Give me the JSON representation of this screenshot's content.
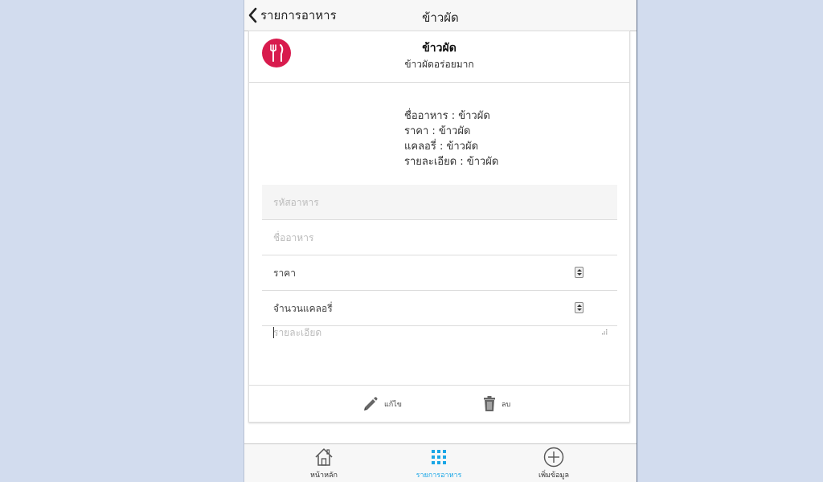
{
  "navbar": {
    "back_label": "รายการอาหาร",
    "title": "ข้าวผัด"
  },
  "card": {
    "title": "ข้าวผัด",
    "subtitle": "ข้าวผัดอร่อยมาก",
    "avatar_color": "#d81b4d",
    "avatar_icon": "fork-knife-icon",
    "info": [
      "ชื่ออาหาร : ข้าวผัด",
      "ราคา : ข้าวผัด",
      "แคลอรี่ : ข้าวผัด",
      "รายละเอียด : ข้าวผัด"
    ]
  },
  "form": {
    "code_placeholder": "รหัสอาหาร",
    "name_placeholder": "ชื่ออาหาร",
    "price_label": "ราคา",
    "calorie_label": "จำนวนแคลอรี่",
    "detail_placeholder": "รายละเอียด"
  },
  "actions": {
    "edit_label": "แก้ไข",
    "delete_label": "ลบ"
  },
  "tabs": [
    {
      "label": "หน้าหลัก",
      "icon": "home-icon",
      "active": false
    },
    {
      "label": "รายการอาหาร",
      "icon": "grid-icon",
      "active": true
    },
    {
      "label": "เพิ่มข้อมูล",
      "icon": "add-circle-icon",
      "active": false
    }
  ],
  "colors": {
    "accent": "#1aa6e6",
    "background": "#d2dcee"
  }
}
